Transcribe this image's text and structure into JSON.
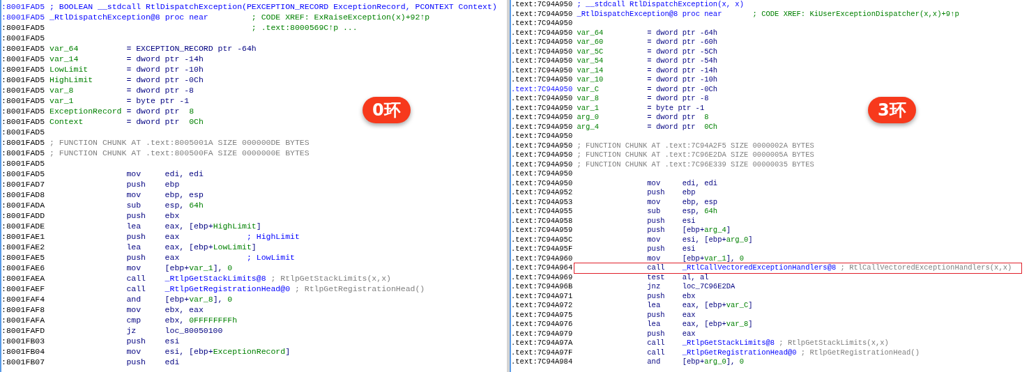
{
  "panels": [
    {
      "badge": "0环",
      "lines": [
        {
          "kind": "header",
          "address": ":8001FAD5",
          "highlighted": true,
          "text": "; BOOLEAN __stdcall RtlDispatchException(PEXCEPTION_RECORD ExceptionRecord, PCONTEXT Context)"
        },
        {
          "kind": "proc",
          "address": ":8001FAD5",
          "highlighted": true,
          "name": "_RtlDispatchException@8 proc near",
          "xref": "; CODE XREF: ExRaiseException(x)+92↑p"
        },
        {
          "kind": "note",
          "address": ":8001FAD5",
          "highlighted": false,
          "text": "; .text:8000569C↑p ..."
        },
        {
          "kind": "blank",
          "address": ":8001FAD5",
          "highlighted": false
        },
        {
          "kind": "var",
          "address": ":8001FAD5",
          "highlighted": false,
          "name": "var_64",
          "value": [
            {
              "kind": "plain",
              "text": "= EXCEPTION_RECORD ptr -64h"
            }
          ]
        },
        {
          "kind": "var",
          "address": ":8001FAD5",
          "highlighted": false,
          "name": "var_14",
          "value": [
            {
              "kind": "plain",
              "text": "= dword ptr -14h"
            }
          ]
        },
        {
          "kind": "var",
          "address": ":8001FAD5",
          "highlighted": false,
          "name": "LowLimit",
          "value": [
            {
              "kind": "plain",
              "text": "= dword ptr -10h"
            }
          ]
        },
        {
          "kind": "var",
          "address": ":8001FAD5",
          "highlighted": false,
          "name": "HighLimit",
          "value": [
            {
              "kind": "plain",
              "text": "= dword ptr -0Ch"
            }
          ]
        },
        {
          "kind": "var",
          "address": ":8001FAD5",
          "highlighted": false,
          "name": "var_8",
          "value": [
            {
              "kind": "plain",
              "text": "= dword ptr -8"
            }
          ]
        },
        {
          "kind": "var",
          "address": ":8001FAD5",
          "highlighted": false,
          "name": "var_1",
          "value": [
            {
              "kind": "plain",
              "text": "= byte ptr -1"
            }
          ]
        },
        {
          "kind": "var",
          "address": ":8001FAD5",
          "highlighted": false,
          "name": "ExceptionRecord",
          "value": [
            {
              "kind": "plain",
              "text": "= dword ptr  "
            },
            {
              "kind": "name",
              "text": "8"
            }
          ]
        },
        {
          "kind": "var",
          "address": ":8001FAD5",
          "highlighted": false,
          "name": "Context",
          "value": [
            {
              "kind": "plain",
              "text": "= dword ptr  "
            },
            {
              "kind": "name",
              "text": "0Ch"
            }
          ]
        },
        {
          "kind": "blank",
          "address": ":8001FAD5",
          "highlighted": false
        },
        {
          "kind": "chunk",
          "address": ":8001FAD5",
          "highlighted": false,
          "text": "; FUNCTION CHUNK AT .text:8005001A SIZE 000000DE BYTES"
        },
        {
          "kind": "chunk",
          "address": ":8001FAD5",
          "highlighted": false,
          "text": "; FUNCTION CHUNK AT .text:800500FA SIZE 0000000E BYTES"
        },
        {
          "kind": "blank",
          "address": ":8001FAD5",
          "highlighted": false
        },
        {
          "kind": "instr",
          "address": ":8001FAD5",
          "highlighted": false,
          "mnemonic": "mov",
          "operands": [
            {
              "kind": "plain",
              "text": "edi, edi"
            }
          ]
        },
        {
          "kind": "instr",
          "address": ":8001FAD7",
          "highlighted": false,
          "mnemonic": "push",
          "operands": [
            {
              "kind": "plain",
              "text": "ebp"
            }
          ]
        },
        {
          "kind": "instr",
          "address": ":8001FAD8",
          "highlighted": false,
          "mnemonic": "mov",
          "operands": [
            {
              "kind": "plain",
              "text": "ebp, esp"
            }
          ]
        },
        {
          "kind": "instr",
          "address": ":8001FADA",
          "highlighted": false,
          "mnemonic": "sub",
          "operands": [
            {
              "kind": "plain",
              "text": "esp, "
            },
            {
              "kind": "name",
              "text": "64h"
            }
          ]
        },
        {
          "kind": "instr",
          "address": ":8001FADD",
          "highlighted": false,
          "mnemonic": "push",
          "operands": [
            {
              "kind": "plain",
              "text": "ebx"
            }
          ]
        },
        {
          "kind": "instr",
          "address": ":8001FADE",
          "highlighted": false,
          "mnemonic": "lea",
          "operands": [
            {
              "kind": "plain",
              "text": "eax, [ebp+"
            },
            {
              "kind": "name",
              "text": "HighLimit"
            },
            {
              "kind": "plain",
              "text": "]"
            }
          ]
        },
        {
          "kind": "instr",
          "address": ":8001FAE1",
          "highlighted": false,
          "mnemonic": "push",
          "operands": [
            {
              "kind": "plain",
              "text": "eax"
            }
          ],
          "comment": {
            "kind": "arg",
            "text": "; HighLimit"
          }
        },
        {
          "kind": "instr",
          "address": ":8001FAE2",
          "highlighted": false,
          "mnemonic": "lea",
          "operands": [
            {
              "kind": "plain",
              "text": "eax, [ebp+"
            },
            {
              "kind": "name",
              "text": "LowLimit"
            },
            {
              "kind": "plain",
              "text": "]"
            }
          ]
        },
        {
          "kind": "instr",
          "address": ":8001FAE5",
          "highlighted": false,
          "mnemonic": "push",
          "operands": [
            {
              "kind": "plain",
              "text": "eax"
            }
          ],
          "comment": {
            "kind": "arg",
            "text": "; LowLimit"
          }
        },
        {
          "kind": "instr",
          "address": ":8001FAE6",
          "highlighted": false,
          "mnemonic": "mov",
          "operands": [
            {
              "kind": "plain",
              "text": "[ebp+"
            },
            {
              "kind": "name",
              "text": "var_1"
            },
            {
              "kind": "plain",
              "text": "], "
            },
            {
              "kind": "name",
              "text": "0"
            }
          ]
        },
        {
          "kind": "instr",
          "address": ":8001FAEA",
          "highlighted": false,
          "mnemonic": "call",
          "operands": [
            {
              "kind": "func",
              "text": "_RtlpGetStackLimits@8"
            }
          ],
          "comment": {
            "kind": "auto",
            "text": "; RtlpGetStackLimits(x,x)"
          }
        },
        {
          "kind": "instr",
          "address": ":8001FAEF",
          "highlighted": false,
          "mnemonic": "call",
          "operands": [
            {
              "kind": "func",
              "text": "_RtlpGetRegistrationHead@0"
            }
          ],
          "comment": {
            "kind": "auto",
            "text": "; RtlpGetRegistrationHead()"
          }
        },
        {
          "kind": "instr",
          "address": ":8001FAF4",
          "highlighted": false,
          "mnemonic": "and",
          "operands": [
            {
              "kind": "plain",
              "text": "[ebp+"
            },
            {
              "kind": "name",
              "text": "var_8"
            },
            {
              "kind": "plain",
              "text": "], "
            },
            {
              "kind": "name",
              "text": "0"
            }
          ]
        },
        {
          "kind": "instr",
          "address": ":8001FAF8",
          "highlighted": false,
          "mnemonic": "mov",
          "operands": [
            {
              "kind": "plain",
              "text": "ebx, eax"
            }
          ]
        },
        {
          "kind": "instr",
          "address": ":8001FAFA",
          "highlighted": false,
          "mnemonic": "cmp",
          "operands": [
            {
              "kind": "plain",
              "text": "ebx, "
            },
            {
              "kind": "name",
              "text": "0FFFFFFFFh"
            }
          ]
        },
        {
          "kind": "instr",
          "address": ":8001FAFD",
          "highlighted": false,
          "mnemonic": "jz",
          "operands": [
            {
              "kind": "plain",
              "text": "loc_80050100"
            }
          ]
        },
        {
          "kind": "instr",
          "address": ":8001FB03",
          "highlighted": false,
          "mnemonic": "push",
          "operands": [
            {
              "kind": "plain",
              "text": "esi"
            }
          ]
        },
        {
          "kind": "instr",
          "address": ":8001FB04",
          "highlighted": false,
          "mnemonic": "mov",
          "operands": [
            {
              "kind": "plain",
              "text": "esi, [ebp+"
            },
            {
              "kind": "name",
              "text": "ExceptionRecord"
            },
            {
              "kind": "plain",
              "text": "]"
            }
          ]
        },
        {
          "kind": "instr",
          "address": ":8001FB07",
          "highlighted": false,
          "mnemonic": "push",
          "operands": [
            {
              "kind": "plain",
              "text": "edi"
            }
          ]
        }
      ]
    },
    {
      "badge": "3环",
      "lines": [
        {
          "kind": "header",
          "address": ".text:7C94A950",
          "highlighted": false,
          "boxed": false,
          "text": "; __stdcall RtlDispatchException(x, x)"
        },
        {
          "kind": "proc",
          "address": ".text:7C94A950",
          "highlighted": false,
          "boxed": false,
          "name": "_RtlDispatchException@8 proc near",
          "xref": "; CODE XREF: KiUserExceptionDispatcher(x,x)+9↑p"
        },
        {
          "kind": "blank",
          "address": ".text:7C94A950",
          "highlighted": false,
          "boxed": false
        },
        {
          "kind": "var",
          "address": ".text:7C94A950",
          "highlighted": false,
          "boxed": false,
          "name": "var_64",
          "value": [
            {
              "kind": "plain",
              "text": "= dword ptr -64h"
            }
          ]
        },
        {
          "kind": "var",
          "address": ".text:7C94A950",
          "highlighted": false,
          "boxed": false,
          "name": "var_60",
          "value": [
            {
              "kind": "plain",
              "text": "= dword ptr -60h"
            }
          ]
        },
        {
          "kind": "var",
          "address": ".text:7C94A950",
          "highlighted": false,
          "boxed": false,
          "name": "var_5C",
          "value": [
            {
              "kind": "plain",
              "text": "= dword ptr -5Ch"
            }
          ]
        },
        {
          "kind": "var",
          "address": ".text:7C94A950",
          "highlighted": false,
          "boxed": false,
          "name": "var_54",
          "value": [
            {
              "kind": "plain",
              "text": "= dword ptr -54h"
            }
          ]
        },
        {
          "kind": "var",
          "address": ".text:7C94A950",
          "highlighted": false,
          "boxed": false,
          "name": "var_14",
          "value": [
            {
              "kind": "plain",
              "text": "= dword ptr -14h"
            }
          ]
        },
        {
          "kind": "var",
          "address": ".text:7C94A950",
          "highlighted": false,
          "boxed": false,
          "name": "var_10",
          "value": [
            {
              "kind": "plain",
              "text": "= dword ptr -10h"
            }
          ]
        },
        {
          "kind": "var",
          "address": ".text:7C94A950",
          "highlighted": true,
          "boxed": false,
          "name": "var_C",
          "value": [
            {
              "kind": "plain",
              "text": "= dword ptr -0Ch"
            }
          ]
        },
        {
          "kind": "var",
          "address": ".text:7C94A950",
          "highlighted": false,
          "boxed": false,
          "name": "var_8",
          "value": [
            {
              "kind": "plain",
              "text": "= dword ptr -8"
            }
          ]
        },
        {
          "kind": "var",
          "address": ".text:7C94A950",
          "highlighted": false,
          "boxed": false,
          "name": "var_1",
          "value": [
            {
              "kind": "plain",
              "text": "= byte ptr -1"
            }
          ]
        },
        {
          "kind": "var",
          "address": ".text:7C94A950",
          "highlighted": false,
          "boxed": false,
          "name": "arg_0",
          "value": [
            {
              "kind": "plain",
              "text": "= dword ptr  "
            },
            {
              "kind": "name",
              "text": "8"
            }
          ]
        },
        {
          "kind": "var",
          "address": ".text:7C94A950",
          "highlighted": false,
          "boxed": false,
          "name": "arg_4",
          "value": [
            {
              "kind": "plain",
              "text": "= dword ptr  "
            },
            {
              "kind": "name",
              "text": "0Ch"
            }
          ]
        },
        {
          "kind": "blank",
          "address": ".text:7C94A950",
          "highlighted": false,
          "boxed": false
        },
        {
          "kind": "chunk",
          "address": ".text:7C94A950",
          "highlighted": false,
          "boxed": false,
          "text": "; FUNCTION CHUNK AT .text:7C94A2F5 SIZE 0000002A BYTES"
        },
        {
          "kind": "chunk",
          "address": ".text:7C94A950",
          "highlighted": false,
          "boxed": false,
          "text": "; FUNCTION CHUNK AT .text:7C96E2DA SIZE 0000005A BYTES"
        },
        {
          "kind": "chunk",
          "address": ".text:7C94A950",
          "highlighted": false,
          "boxed": false,
          "text": "; FUNCTION CHUNK AT .text:7C96E339 SIZE 00000035 BYTES"
        },
        {
          "kind": "blank",
          "address": ".text:7C94A950",
          "highlighted": false,
          "boxed": false
        },
        {
          "kind": "instr",
          "address": ".text:7C94A950",
          "highlighted": false,
          "boxed": false,
          "mnemonic": "mov",
          "operands": [
            {
              "kind": "plain",
              "text": "edi, edi"
            }
          ]
        },
        {
          "kind": "instr",
          "address": ".text:7C94A952",
          "highlighted": false,
          "boxed": false,
          "mnemonic": "push",
          "operands": [
            {
              "kind": "plain",
              "text": "ebp"
            }
          ]
        },
        {
          "kind": "instr",
          "address": ".text:7C94A953",
          "highlighted": false,
          "boxed": false,
          "mnemonic": "mov",
          "operands": [
            {
              "kind": "plain",
              "text": "ebp, esp"
            }
          ]
        },
        {
          "kind": "instr",
          "address": ".text:7C94A955",
          "highlighted": false,
          "boxed": false,
          "mnemonic": "sub",
          "operands": [
            {
              "kind": "plain",
              "text": "esp, "
            },
            {
              "kind": "name",
              "text": "64h"
            }
          ]
        },
        {
          "kind": "instr",
          "address": ".text:7C94A958",
          "highlighted": false,
          "boxed": false,
          "mnemonic": "push",
          "operands": [
            {
              "kind": "plain",
              "text": "esi"
            }
          ]
        },
        {
          "kind": "instr",
          "address": ".text:7C94A959",
          "highlighted": false,
          "boxed": false,
          "mnemonic": "push",
          "operands": [
            {
              "kind": "plain",
              "text": "[ebp+"
            },
            {
              "kind": "name",
              "text": "arg_4"
            },
            {
              "kind": "plain",
              "text": "]"
            }
          ]
        },
        {
          "kind": "instr",
          "address": ".text:7C94A95C",
          "highlighted": false,
          "boxed": false,
          "mnemonic": "mov",
          "operands": [
            {
              "kind": "plain",
              "text": "esi, [ebp+"
            },
            {
              "kind": "name",
              "text": "arg_0"
            },
            {
              "kind": "plain",
              "text": "]"
            }
          ]
        },
        {
          "kind": "instr",
          "address": ".text:7C94A95F",
          "highlighted": false,
          "boxed": false,
          "mnemonic": "push",
          "operands": [
            {
              "kind": "plain",
              "text": "esi"
            }
          ]
        },
        {
          "kind": "instr",
          "address": ".text:7C94A960",
          "highlighted": false,
          "boxed": false,
          "mnemonic": "mov",
          "operands": [
            {
              "kind": "plain",
              "text": "[ebp+"
            },
            {
              "kind": "name",
              "text": "var_1"
            },
            {
              "kind": "plain",
              "text": "], "
            },
            {
              "kind": "name",
              "text": "0"
            }
          ]
        },
        {
          "kind": "instr",
          "address": ".text:7C94A964",
          "highlighted": false,
          "boxed": true,
          "mnemonic": "call",
          "operands": [
            {
              "kind": "func",
              "text": "_RtlCallVectoredExceptionHandlers@8"
            }
          ],
          "comment": {
            "kind": "auto",
            "text": "; RtlCallVectoredExceptionHandlers(x,x)"
          }
        },
        {
          "kind": "instr",
          "address": ".text:7C94A969",
          "highlighted": false,
          "boxed": false,
          "mnemonic": "test",
          "operands": [
            {
              "kind": "plain",
              "text": "al, al"
            }
          ]
        },
        {
          "kind": "instr",
          "address": ".text:7C94A96B",
          "highlighted": false,
          "boxed": false,
          "mnemonic": "jnz",
          "operands": [
            {
              "kind": "plain",
              "text": "loc_7C96E2DA"
            }
          ]
        },
        {
          "kind": "instr",
          "address": ".text:7C94A971",
          "highlighted": false,
          "boxed": false,
          "mnemonic": "push",
          "operands": [
            {
              "kind": "plain",
              "text": "ebx"
            }
          ]
        },
        {
          "kind": "instr",
          "address": ".text:7C94A972",
          "highlighted": false,
          "boxed": false,
          "mnemonic": "lea",
          "operands": [
            {
              "kind": "plain",
              "text": "eax, [ebp+"
            },
            {
              "kind": "name",
              "text": "var_C"
            },
            {
              "kind": "plain",
              "text": "]"
            }
          ]
        },
        {
          "kind": "instr",
          "address": ".text:7C94A975",
          "highlighted": false,
          "boxed": false,
          "mnemonic": "push",
          "operands": [
            {
              "kind": "plain",
              "text": "eax"
            }
          ]
        },
        {
          "kind": "instr",
          "address": ".text:7C94A976",
          "highlighted": false,
          "boxed": false,
          "mnemonic": "lea",
          "operands": [
            {
              "kind": "plain",
              "text": "eax, [ebp+"
            },
            {
              "kind": "name",
              "text": "var_8"
            },
            {
              "kind": "plain",
              "text": "]"
            }
          ]
        },
        {
          "kind": "instr",
          "address": ".text:7C94A979",
          "highlighted": false,
          "boxed": false,
          "mnemonic": "push",
          "operands": [
            {
              "kind": "plain",
              "text": "eax"
            }
          ]
        },
        {
          "kind": "instr",
          "address": ".text:7C94A97A",
          "highlighted": false,
          "boxed": false,
          "mnemonic": "call",
          "operands": [
            {
              "kind": "func",
              "text": "_RtlpGetStackLimits@8"
            }
          ],
          "comment": {
            "kind": "auto",
            "text": "; RtlpGetStackLimits(x,x)"
          }
        },
        {
          "kind": "instr",
          "address": ".text:7C94A97F",
          "highlighted": false,
          "boxed": false,
          "mnemonic": "call",
          "operands": [
            {
              "kind": "func",
              "text": "_RtlpGetRegistrationHead@0"
            }
          ],
          "comment": {
            "kind": "auto",
            "text": "; RtlpGetRegistrationHead()"
          }
        },
        {
          "kind": "instr",
          "address": ".text:7C94A984",
          "highlighted": false,
          "boxed": false,
          "mnemonic": "and",
          "operands": [
            {
              "kind": "plain",
              "text": "[ebp+"
            },
            {
              "kind": "name",
              "text": "arg_0"
            },
            {
              "kind": "plain",
              "text": "], "
            },
            {
              "kind": "name",
              "text": "0"
            }
          ]
        }
      ]
    }
  ]
}
